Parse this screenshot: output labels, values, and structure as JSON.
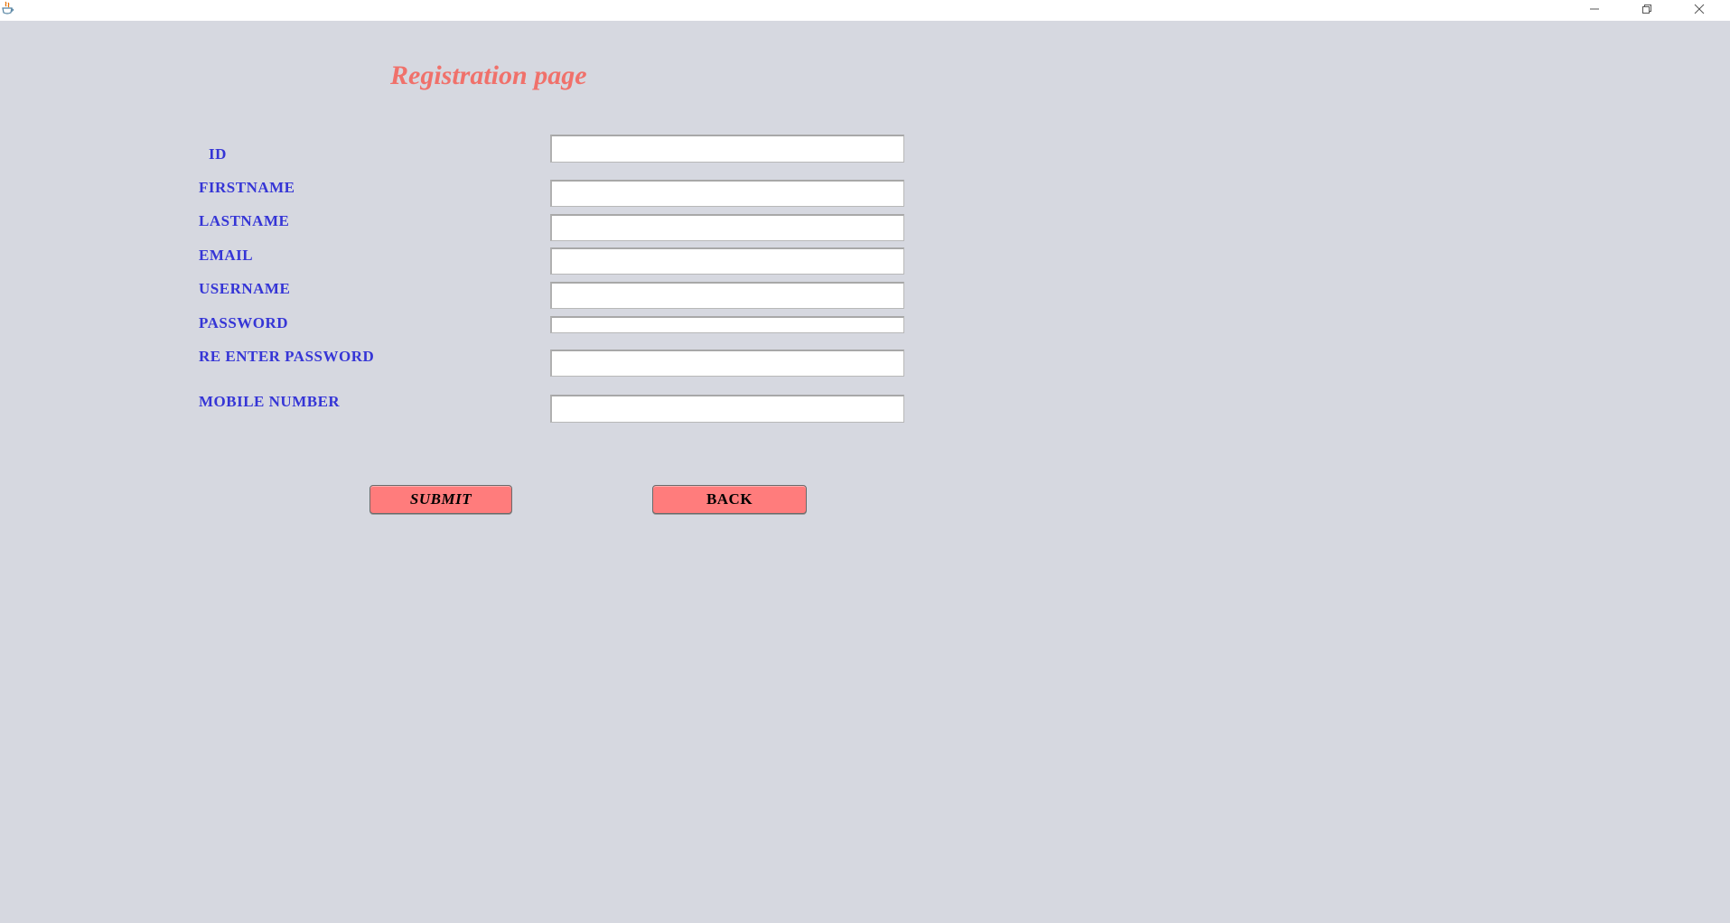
{
  "window": {
    "icons": {
      "app": "java-icon",
      "minimize": "minimize-icon",
      "maximize": "maximize-icon",
      "close": "close-icon"
    }
  },
  "page": {
    "title": "Registration page"
  },
  "form": {
    "id_label": "ID",
    "firstname_label": "FIRSTNAME",
    "lastname_label": "LASTNAME",
    "email_label": "EMAIL",
    "username_label": "USERNAME",
    "password_label": "PASSWORD",
    "reenter_password_label": "RE ENTER PASSWORD",
    "mobile_label": "MOBILE NUMBER",
    "id_value": "",
    "firstname_value": "",
    "lastname_value": "",
    "email_value": "",
    "username_value": "",
    "password_value": "",
    "reenter_password_value": "",
    "mobile_value": ""
  },
  "buttons": {
    "submit_label": "SUBMIT",
    "back_label": "BACK"
  },
  "colors": {
    "background": "#d6d8e0",
    "title": "#f0716b",
    "label": "#3535d6",
    "button": "#ff7c7c"
  }
}
